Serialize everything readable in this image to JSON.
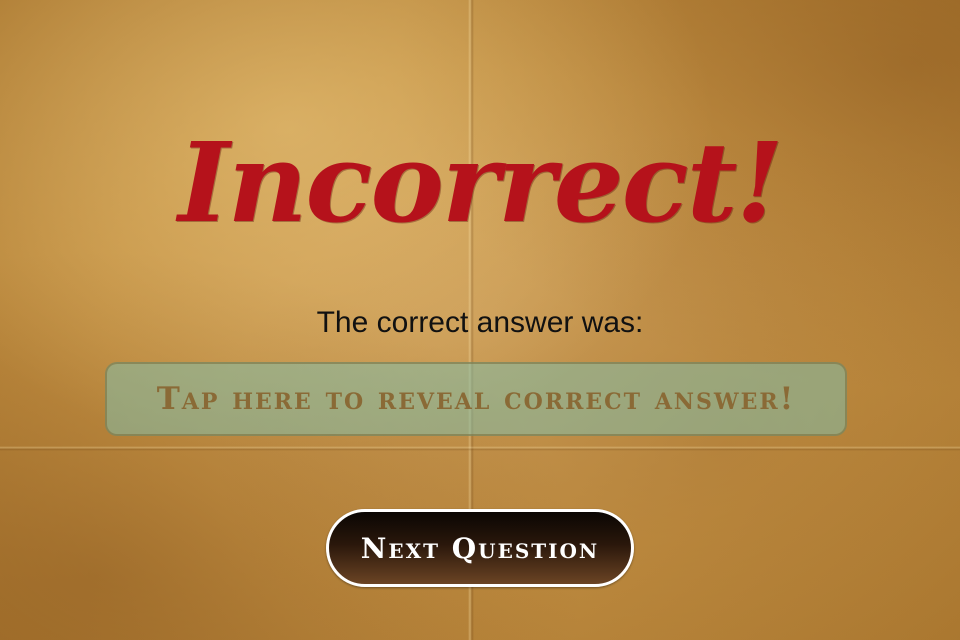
{
  "result": {
    "title": "Incorrect!",
    "title_color": "#b5121b"
  },
  "answer": {
    "prompt": "The correct answer was:",
    "reveal_label": "Tap here to reveal correct answer!"
  },
  "actions": {
    "next_label": "Next Question"
  },
  "colors": {
    "parchment": "#c49143",
    "reveal_box": "#82beaa",
    "button_bg": "#2a170b"
  }
}
